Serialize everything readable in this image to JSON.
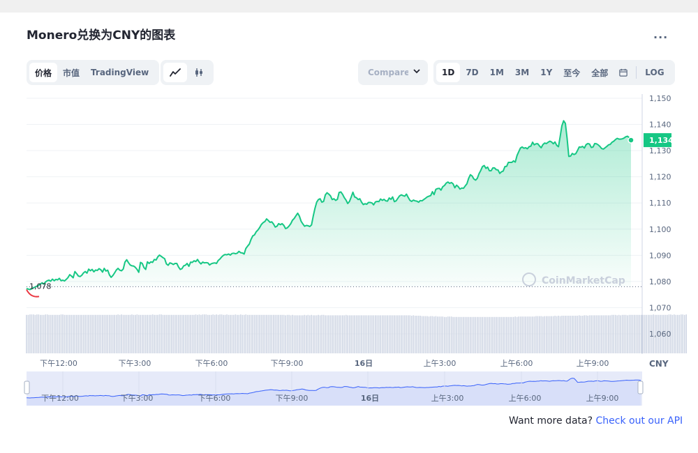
{
  "title": "Monero兑换为CNY的图表",
  "more_label": "...",
  "left_tabs": [
    {
      "label": "价格",
      "active": true
    },
    {
      "label": "市值",
      "active": false
    },
    {
      "label": "TradingView",
      "active": false
    }
  ],
  "chart_type_icons": [
    {
      "icon": "line-chart-icon",
      "active": true
    },
    {
      "icon": "candlestick-icon",
      "active": false
    }
  ],
  "compare_label": "Compare w",
  "range_tabs": [
    {
      "label": "1D",
      "active": true
    },
    {
      "label": "7D",
      "active": false
    },
    {
      "label": "1M",
      "active": false
    },
    {
      "label": "3M",
      "active": false
    },
    {
      "label": "1Y",
      "active": false
    },
    {
      "label": "至今",
      "active": false
    },
    {
      "label": "全部",
      "active": false
    }
  ],
  "calendar_icon": "calendar-icon",
  "log_label": "LOG",
  "watermark": "CoinMarketCap",
  "api_prefix": "Want more data?",
  "api_link": "Check out our API",
  "colors": {
    "up": "#16c784",
    "down": "#ea3943",
    "navigator": "#3861fb"
  },
  "chart_data": {
    "type": "area",
    "title": "",
    "currency_label": "CNY",
    "ylim": [
      1055,
      1152
    ],
    "yticks": [
      1150,
      1140,
      1130,
      1120,
      1110,
      1100,
      1090,
      1080,
      1070,
      1060
    ],
    "ytick_labels": [
      "1,150",
      "1,140",
      "1,130",
      "1,120",
      "1,110",
      "1,100",
      "1,090",
      "1,080",
      "1,070",
      "1,060"
    ],
    "baseline_value": 1078,
    "baseline_label": "1,078",
    "current_value": 1134,
    "current_label": "1,134",
    "xtick_labels": [
      "下午12:00",
      "下午3:00",
      "下午6:00",
      "下午9:00",
      "16日",
      "上午3:00",
      "上午6:00",
      "上午9:00"
    ],
    "navigator_xtick_labels": [
      "下午12:00",
      "下午3:00",
      "下午6:00",
      "下午9:00",
      "16日",
      "上午3:00",
      "上午6:00",
      "上午9:00"
    ],
    "series": [
      {
        "values": [
          1077.3,
          1077.1,
          1076.9,
          1077.2,
          1077.6,
          1077.9,
          1078.2,
          1078.5,
          1079.0,
          1079.5,
          1079.0,
          1079.8,
          1080.3,
          1080.5,
          1080.1,
          1080.9,
          1080.3,
          1080.8,
          1080.6,
          1081.2,
          1080.3,
          1080.5,
          1080.2,
          1080.8,
          1081.5,
          1082.6,
          1082.1,
          1081.4,
          1083.8,
          1083.0,
          1082.1,
          1081.9,
          1082.4,
          1083.3,
          1083.8,
          1083.2,
          1084.7,
          1084.1,
          1084.6,
          1083.7,
          1084.4,
          1084.2,
          1084.9,
          1084.5,
          1083.6,
          1085.0,
          1084.0,
          1084.3,
          1082.5,
          1081.6,
          1082.3,
          1083.3,
          1084.4,
          1085.0,
          1084.3,
          1084.1,
          1084.8,
          1087.4,
          1088.3,
          1087.2,
          1086.3,
          1086.0,
          1085.9,
          1085.4,
          1084.6,
          1083.5,
          1087.3,
          1086.9,
          1085.3,
          1084.6,
          1087.5,
          1086.9,
          1087.5,
          1087.3,
          1088.4,
          1088.2,
          1089.4,
          1090.1,
          1089.6,
          1089.1,
          1088.7,
          1086.7,
          1086.2,
          1087.1,
          1086.9,
          1086.5,
          1086.9,
          1086.9,
          1085.6,
          1084.6,
          1084.9,
          1086.0,
          1086.2,
          1086.9,
          1085.8,
          1087.4,
          1087.3,
          1087.9,
          1087.6,
          1088.4,
          1087.4,
          1086.7,
          1087.4,
          1087.1,
          1087.2,
          1087.1,
          1086.3,
          1086.8,
          1087.0,
          1087.1,
          1086.9,
          1088.0,
          1088.6,
          1089.4,
          1090.0,
          1090.3,
          1090.2,
          1090.5,
          1090.1,
          1090.7,
          1090.8,
          1090.6,
          1090.8,
          1091.5,
          1091.0,
          1090.9,
          1090.5,
          1092.6,
          1093.5,
          1094.3,
          1096.1,
          1097.4,
          1097.8,
          1099.0,
          1099.7,
          1100.6,
          1101.8,
          1102.5,
          1102.9,
          1103.9,
          1103.3,
          1102.6,
          1102.8,
          1102.0,
          1100.8,
          1101.1,
          1102.1,
          1101.7,
          1102.1,
          1101.4,
          1100.2,
          1100.5,
          1101.2,
          1102.1,
          1103.4,
          1104.1,
          1105.1,
          1106.1,
          1105.0,
          1103.0,
          1102.0,
          1101.1,
          1101.4,
          1101.3,
          1101.0,
          1101.6,
          1104.9,
          1107.9,
          1110.3,
          1111.3,
          1111.6,
          1110.3,
          1110.6,
          1113.1,
          1113.9,
          1113.4,
          1112.7,
          1111.3,
          1111.6,
          1111.0,
          1111.4,
          1114.0,
          1114.2,
          1113.3,
          1112.0,
          1111.1,
          1109.8,
          1110.6,
          1112.3,
          1114.1,
          1112.3,
          1112.0,
          1111.3,
          1111.6,
          1110.3,
          1109.4,
          1109.7,
          1109.5,
          1110.2,
          1110.2,
          1110.0,
          1109.3,
          1110.4,
          1110.6,
          1110.5,
          1111.5,
          1111.0,
          1111.4,
          1110.8,
          1110.7,
          1111.9,
          1111.4,
          1112.3,
          1110.5,
          1110.8,
          1111.8,
          1112.7,
          1113.1,
          1112.8,
          1112.6,
          1113.4,
          1112.1,
          1111.0,
          1110.6,
          1111.1,
          1110.8,
          1110.7,
          1110.3,
          1110.9,
          1110.8,
          1111.3,
          1111.8,
          1112.3,
          1112.6,
          1112.8,
          1114.3,
          1113.2,
          1115.2,
          1115.5,
          1115.6,
          1114.9,
          1116.2,
          1116.7,
          1117.6,
          1118.0,
          1117.5,
          1117.8,
          1117.3,
          1115.8,
          1116.8,
          1116.2,
          1115.3,
          1115.7,
          1115.6,
          1116.5,
          1117.3,
          1119.4,
          1120.8,
          1120.3,
          1119.2,
          1118.7,
          1119.4,
          1121.2,
          1122.4,
          1123.9,
          1124.3,
          1123.2,
          1123.7,
          1122.3,
          1122.3,
          1123.4,
          1123.4,
          1122.7,
          1122.6,
          1121.3,
          1121.9,
          1122.2,
          1123.9,
          1124.0,
          1125.5,
          1125.5,
          1125.5,
          1126.1,
          1125.6,
          1128.1,
          1129.6,
          1131.0,
          1131.4,
          1130.9,
          1131.1,
          1130.7,
          1131.5,
          1131.7,
          1133.2,
          1132.2,
          1132.6,
          1132.6,
          1131.8,
          1131.1,
          1132.3,
          1132.9,
          1132.7,
          1133.2,
          1133.6,
          1133.3,
          1132.6,
          1133.3,
          1132.0,
          1131.5,
          1135.5,
          1139.5,
          1141.4,
          1140.4,
          1134.6,
          1127.8,
          1127.9,
          1128.9,
          1128.5,
          1128.8,
          1130.0,
          1131.4,
          1131.3,
          1131.6,
          1131.0,
          1132.3,
          1132.7,
          1132.5,
          1131.2,
          1131.4,
          1132.7,
          1132.6,
          1132.2,
          1131.6,
          1130.8,
          1130.6,
          1131.1,
          1131.6,
          1132.2,
          1132.4,
          1133.2,
          1133.6,
          1134.2,
          1134.7,
          1134.4,
          1134.4,
          1134.5,
          1134.8,
          1135.3,
          1135.5,
          1134.9,
          1134.0
        ]
      }
    ],
    "volume_relative": [
      0.92,
      0.92,
      0.93,
      0.93,
      0.93,
      0.92,
      0.93,
      0.93,
      0.92,
      0.92,
      0.92,
      0.93,
      0.93,
      0.92,
      0.92,
      0.92,
      0.92,
      0.92,
      0.92,
      0.92,
      0.93,
      0.93,
      0.92,
      0.92,
      0.92,
      0.92,
      0.92,
      0.92,
      0.92,
      0.92,
      0.92,
      0.92,
      0.92,
      0.92,
      0.92,
      0.92,
      0.92,
      0.92,
      0.92,
      0.92,
      0.92,
      0.92,
      0.92,
      0.92,
      0.92,
      0.92,
      0.92,
      0.92,
      0.92,
      0.92,
      0.92,
      0.92,
      0.92,
      0.93,
      0.92,
      0.93,
      0.92,
      0.92,
      0.92,
      0.92,
      0.92,
      0.93,
      0.92,
      0.92,
      0.93,
      0.92,
      0.92,
      0.92,
      0.92,
      0.92,
      0.92,
      0.92,
      0.92,
      0.93,
      0.92,
      0.92,
      0.92,
      0.93,
      0.93,
      0.92,
      0.92,
      0.92,
      0.92,
      0.92,
      0.92,
      0.92,
      0.92,
      0.92,
      0.92,
      0.92,
      0.92,
      0.92,
      0.92,
      0.92,
      0.92,
      0.92,
      0.92,
      0.92,
      0.93,
      0.92,
      0.93,
      0.92,
      0.93,
      0.93,
      0.93,
      0.92,
      0.92,
      0.92,
      0.93,
      0.92,
      0.93,
      0.92,
      0.93,
      0.93,
      0.92,
      0.92,
      0.93,
      0.92,
      0.92,
      0.92,
      0.92,
      0.93,
      0.92,
      0.92,
      0.93,
      0.92,
      0.92,
      0.93,
      0.92,
      0.92,
      0.92,
      0.92,
      0.92,
      0.92,
      0.92,
      0.92,
      0.92,
      0.92,
      0.92,
      0.92,
      0.92,
      0.92,
      0.92,
      0.92,
      0.92,
      0.92,
      0.92,
      0.92,
      0.92,
      0.92,
      0.91,
      0.92,
      0.92,
      0.91,
      0.92,
      0.91,
      0.91,
      0.91,
      0.91,
      0.91,
      0.91,
      0.92,
      0.91,
      0.92,
      0.91,
      0.92,
      0.91,
      0.91,
      0.91,
      0.92,
      0.91,
      0.92,
      0.92,
      0.91,
      0.91,
      0.91,
      0.91,
      0.91,
      0.91,
      0.91,
      0.91,
      0.91,
      0.91,
      0.91,
      0.91,
      0.92,
      0.91,
      0.91,
      0.91,
      0.91,
      0.91,
      0.91,
      0.91,
      0.91,
      0.91,
      0.91,
      0.91,
      0.91,
      0.91,
      0.91,
      0.91,
      0.91,
      0.91,
      0.91,
      0.91,
      0.91,
      0.91,
      0.91,
      0.91,
      0.91,
      0.91,
      0.91,
      0.91,
      0.91,
      0.91,
      0.91,
      0.91,
      0.91,
      0.91,
      0.91,
      0.91,
      0.91,
      0.91,
      0.9,
      0.91,
      0.9,
      0.9,
      0.9,
      0.9,
      0.89,
      0.89,
      0.89,
      0.89,
      0.88,
      0.89,
      0.89,
      0.88,
      0.89,
      0.88,
      0.88,
      0.88,
      0.88,
      0.87,
      0.87,
      0.88,
      0.88,
      0.88,
      0.87,
      0.87,
      0.87,
      0.87,
      0.87,
      0.87,
      0.87,
      0.87,
      0.87,
      0.87,
      0.87,
      0.87,
      0.87,
      0.87,
      0.87,
      0.87,
      0.87,
      0.87,
      0.87,
      0.87,
      0.87,
      0.87,
      0.87,
      0.87,
      0.87,
      0.87,
      0.87,
      0.87,
      0.87,
      0.87,
      0.87,
      0.87,
      0.87,
      0.87,
      0.87,
      0.87,
      0.88,
      0.87,
      0.88,
      0.88,
      0.88,
      0.88,
      0.88,
      0.88,
      0.88,
      0.88,
      0.88,
      0.88,
      0.89,
      0.89,
      0.89,
      0.89,
      0.88,
      0.89,
      0.89,
      0.89,
      0.89,
      0.89,
      0.89,
      0.9,
      0.89,
      0.9,
      0.89,
      0.9,
      0.9,
      0.9,
      0.9,
      0.9,
      0.9,
      0.9,
      0.9,
      0.9,
      0.9,
      0.91,
      0.9,
      0.9,
      0.91,
      0.91,
      0.9,
      0.91,
      0.91,
      0.91,
      0.91,
      0.91,
      0.91,
      0.91,
      0.91,
      0.91,
      0.91,
      0.91,
      0.91,
      0.91,
      0.92,
      0.92,
      0.92,
      0.91,
      0.92,
      0.91,
      0.92,
      0.92,
      0.92,
      0.91,
      0.92,
      0.92,
      0.92,
      0.92,
      0.92,
      0.92,
      0.92,
      0.92,
      0.92,
      0.92,
      0.92,
      0.92,
      0.92,
      0.92,
      0.93,
      0.92,
      0.92,
      0.92,
      0.92,
      0.92,
      0.92,
      0.92,
      0.92,
      0.93,
      0.93,
      0.92,
      0.93,
      0.92,
      0.92,
      0.92,
      0.93,
      0.93,
      0.92,
      0.93
    ]
  }
}
